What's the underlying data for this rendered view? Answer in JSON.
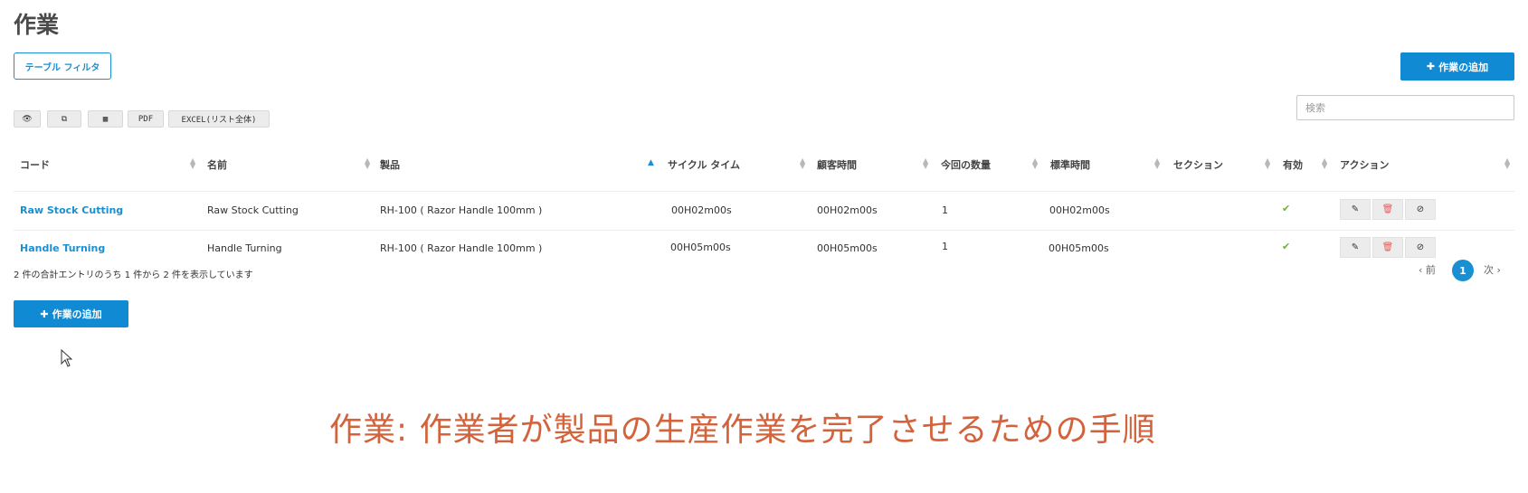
{
  "page": {
    "title": "作業"
  },
  "toolbar": {
    "filter_label": "テーブル フィルタ",
    "add_label": "作業の追加",
    "search_placeholder": "検索",
    "export_buttons": [
      {
        "icon": "eye-icon",
        "label": "👁"
      },
      {
        "icon": "copy-icon",
        "label": "⧉"
      },
      {
        "icon": "grid-icon",
        "label": "▦"
      },
      {
        "label": "PDF"
      },
      {
        "label": "EXCEL(リスト全体)"
      }
    ]
  },
  "table": {
    "columns": [
      "コード",
      "名前",
      "製品",
      "サイクル タイム",
      "顧客時間",
      "今回の数量",
      "標準時間",
      "セクション",
      "有効",
      "アクション"
    ],
    "rows": [
      {
        "code": "Raw Stock Cutting",
        "name": "Raw Stock Cutting",
        "product": "RH-100 ( Razor Handle 100mm )",
        "cycle_time": "00H02m00s",
        "customer_time": "00H02m00s",
        "quantity": "1",
        "standard_time": "00H02m00s",
        "section": "",
        "enabled": "✔"
      },
      {
        "code": "Handle Turning",
        "name": "Handle Turning",
        "product": "RH-100 ( Razor Handle 100mm )",
        "cycle_time": "00H05m00s",
        "customer_time": "00H05m00s",
        "quantity": "1",
        "standard_time": "00H05m00s",
        "section": "",
        "enabled": "✔"
      }
    ]
  },
  "footer": {
    "entries_text": "2 件の合計エントリのうち 1 件から 2 件を表示しています",
    "prev_label": "‹ 前",
    "current_page": "1",
    "next_label": "次 ›"
  },
  "caption": "作業: 作業者が製品の生産作業を完了させるための手順",
  "colors": {
    "accent": "#108ad2",
    "caption": "#d2633d",
    "enabled_check": "#67b530"
  }
}
